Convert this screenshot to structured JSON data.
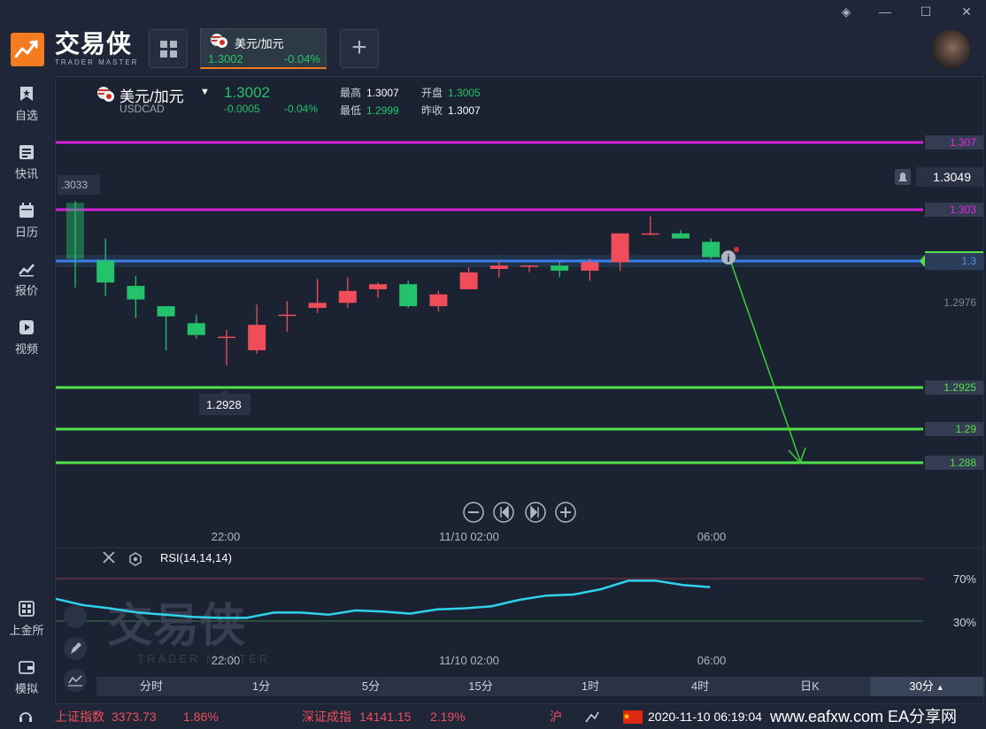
{
  "app": {
    "brand_cn": "交易侠",
    "brand_en": "TRADER MASTER"
  },
  "symbol_tab": {
    "name": "美元/加元",
    "price": "1.3002",
    "change_pct": "-0.04%"
  },
  "header": {
    "name": "美元/加元",
    "code": "USDCAD",
    "price": "1.3002",
    "change": "-0.0005",
    "change_pct": "-0.04%",
    "high_label": "最高",
    "high": "1.3007",
    "open_label": "开盘",
    "open": "1.3005",
    "low_label": "最低",
    "low": "1.2999",
    "prev_label": "昨收",
    "prev": "1.3007"
  },
  "sidebar": {
    "items": [
      {
        "label": "自选",
        "icon": "star-bookmark-icon"
      },
      {
        "label": "快讯",
        "icon": "news-icon"
      },
      {
        "label": "日历",
        "icon": "calendar-icon"
      },
      {
        "label": "报价",
        "icon": "quote-chart-icon"
      },
      {
        "label": "视频",
        "icon": "video-icon"
      },
      {
        "label": "上金所",
        "icon": "gold-exchange-icon"
      },
      {
        "label": "模拟",
        "icon": "wallet-icon"
      }
    ]
  },
  "levels": {
    "l1307": "1.307",
    "l1303": "1.303",
    "l13": "1.3",
    "l12925": "1.2925",
    "l129": "1.29",
    "l1288": "1.288",
    "current": "1.3049",
    "axis_12976": "1.2976",
    "left_3033": ".3033",
    "low_marker": "1.2928"
  },
  "time_labels": [
    "22:00",
    "11/10 02:00",
    "06:00"
  ],
  "rsi": {
    "label": "RSI(14,14,14)",
    "level_70": "70%",
    "level_30": "30%",
    "watermark": "交易侠",
    "watermark_en": "TRADER MASTER"
  },
  "timeframes": [
    "分时",
    "1分",
    "5分",
    "15分",
    "1时",
    "4时",
    "日K",
    "30分"
  ],
  "active_timeframe": "30分",
  "status": {
    "sh_label": "上证指数",
    "sh_value": "3373.73",
    "sh_pct": "1.86%",
    "sz_label": "深证成指",
    "sz_value": "14141.15",
    "sz_pct": "2.19%",
    "hu_label": "沪",
    "datetime": "2020-11-10 06:19:04",
    "watermark": "www.eafxw.com  EA分享网"
  },
  "colors": {
    "green": "#24c26a",
    "red": "#ef4d5a",
    "magenta": "#d81ed8",
    "blue": "#3a7ee8",
    "lightgreen": "#4fe04a",
    "rsi": "#2ed3ea",
    "orange": "#f47b20"
  },
  "chart_data": {
    "type": "candlestick",
    "candles": [
      {
        "o": 1.3034,
        "h": 1.3035,
        "l": 1.2984,
        "c": 1.3001
      },
      {
        "o": 1.3,
        "h": 1.3013,
        "l": 1.2979,
        "c": 1.2987
      },
      {
        "o": 1.2985,
        "h": 1.2991,
        "l": 1.2966,
        "c": 1.2977
      },
      {
        "o": 1.2973,
        "h": 1.2973,
        "l": 1.2947,
        "c": 1.2967
      },
      {
        "o": 1.2963,
        "h": 1.2968,
        "l": 1.2954,
        "c": 1.2956
      },
      {
        "o": 1.2955,
        "h": 1.2959,
        "l": 1.2938,
        "c": 1.2955
      },
      {
        "o": 1.2947,
        "h": 1.2974,
        "l": 1.2945,
        "c": 1.2962
      },
      {
        "o": 1.2968,
        "h": 1.2976,
        "l": 1.2958,
        "c": 1.2968
      },
      {
        "o": 1.2972,
        "h": 1.2989,
        "l": 1.2969,
        "c": 1.2975
      },
      {
        "o": 1.2975,
        "h": 1.299,
        "l": 1.2972,
        "c": 1.2982
      },
      {
        "o": 1.2983,
        "h": 1.2987,
        "l": 1.2978,
        "c": 1.2986
      },
      {
        "o": 1.2986,
        "h": 1.2988,
        "l": 1.2972,
        "c": 1.2973
      },
      {
        "o": 1.2973,
        "h": 1.2982,
        "l": 1.297,
        "c": 1.298
      },
      {
        "o": 1.2983,
        "h": 1.2996,
        "l": 1.2983,
        "c": 1.2993
      },
      {
        "o": 1.2995,
        "h": 1.3,
        "l": 1.299,
        "c": 1.2997
      },
      {
        "o": 1.2997,
        "h": 1.2997,
        "l": 1.2993,
        "c": 1.2997
      },
      {
        "o": 1.2997,
        "h": 1.3,
        "l": 1.299,
        "c": 1.2994
      },
      {
        "o": 1.2994,
        "h": 1.3001,
        "l": 1.2988,
        "c": 1.2999
      },
      {
        "o": 1.2999,
        "h": 1.3016,
        "l": 1.2994,
        "c": 1.3016
      },
      {
        "o": 1.3016,
        "h": 1.3026,
        "l": 1.3015,
        "c": 1.3016
      },
      {
        "o": 1.3016,
        "h": 1.3018,
        "l": 1.3013,
        "c": 1.3013
      },
      {
        "o": 1.3011,
        "h": 1.3013,
        "l": 1.3001,
        "c": 1.3002
      }
    ],
    "horizontal_levels": [
      1.307,
      1.303,
      1.3,
      1.2925,
      1.29,
      1.288
    ],
    "projection": {
      "from": 1.3002,
      "to": 1.288
    },
    "rsi_values": [
      51,
      45,
      42,
      38,
      36,
      34,
      33,
      33,
      38,
      38,
      36,
      40,
      39,
      37,
      41,
      42,
      44,
      50,
      54,
      55,
      60,
      68,
      68,
      64,
      62
    ]
  }
}
